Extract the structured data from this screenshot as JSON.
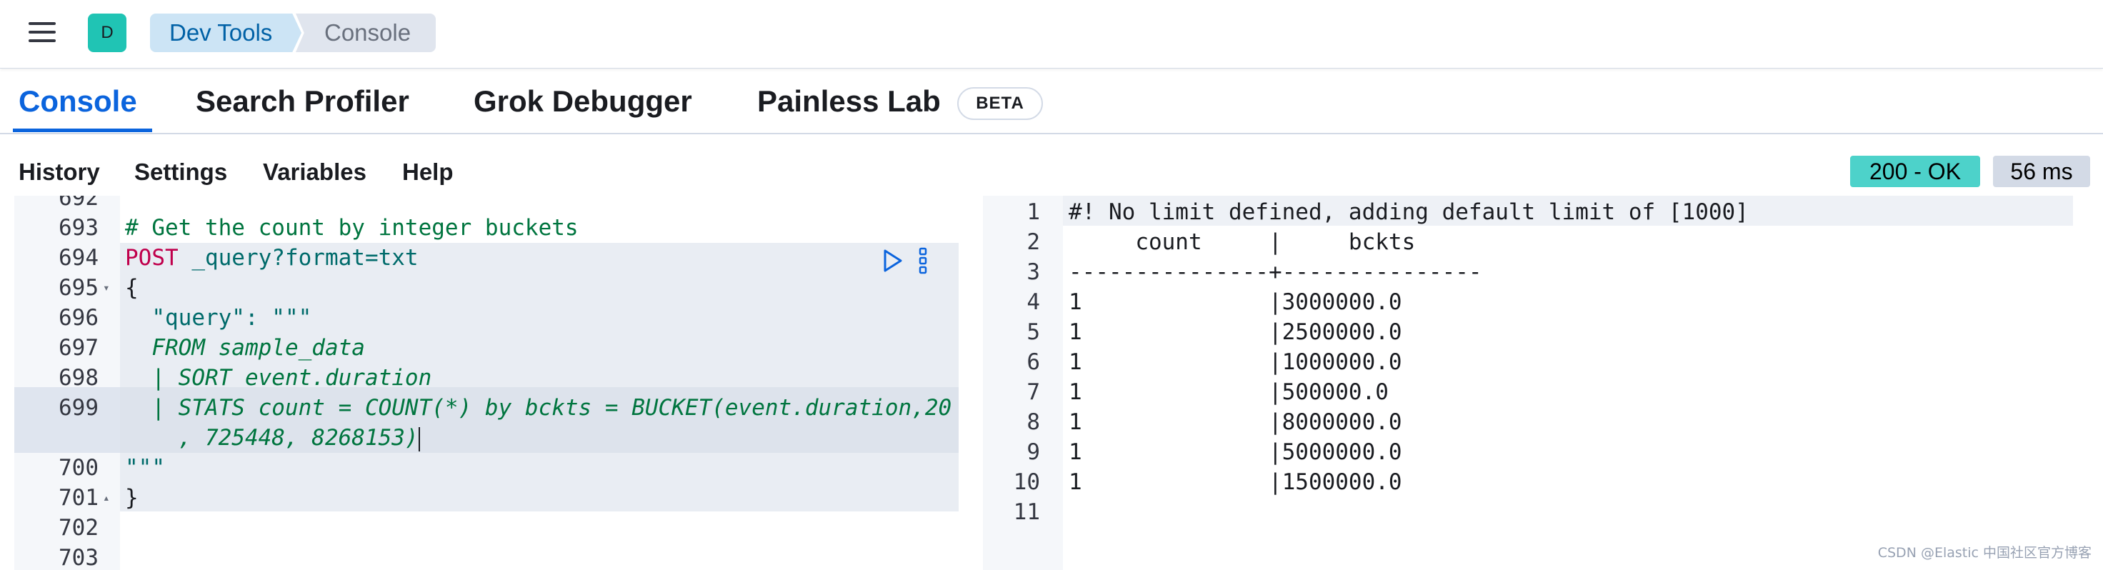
{
  "header": {
    "avatar_letter": "D",
    "breadcrumbs": [
      "Dev Tools",
      "Console"
    ]
  },
  "tabs": [
    {
      "label": "Console",
      "active": true
    },
    {
      "label": "Search Profiler",
      "active": false
    },
    {
      "label": "Grok Debugger",
      "active": false
    },
    {
      "label": "Painless Lab",
      "active": false,
      "badge": "BETA"
    }
  ],
  "toolbar": {
    "items": [
      "History",
      "Settings",
      "Variables",
      "Help"
    ],
    "status": "200 - OK",
    "time": "56 ms"
  },
  "editor": {
    "lines": [
      {
        "num": "692",
        "text": ""
      },
      {
        "num": "693",
        "text": "# Get the count by integer buckets"
      },
      {
        "num": "694",
        "verb": "POST",
        "text": " _query?format=txt"
      },
      {
        "num": "695",
        "text": "{"
      },
      {
        "num": "696",
        "text": "  \"query\": \"\"\""
      },
      {
        "num": "697",
        "text": "  FROM sample_data"
      },
      {
        "num": "698",
        "text": "  | SORT event.duration"
      },
      {
        "num": "699",
        "text": "  | STATS count = COUNT(*) by bckts = BUCKET(event.duration,20"
      },
      {
        "num": "",
        "text": "    , 725448, 8268153)"
      },
      {
        "num": "700",
        "text": "\"\"\""
      },
      {
        "num": "701",
        "text": "}"
      },
      {
        "num": "702",
        "text": ""
      },
      {
        "num": "703",
        "text": ""
      }
    ]
  },
  "output": {
    "lines": [
      {
        "num": "1",
        "text": "#! No limit defined, adding default limit of [1000]"
      },
      {
        "num": "2",
        "text": "     count     |     bckts     "
      },
      {
        "num": "3",
        "text": "---------------+---------------"
      },
      {
        "num": "4",
        "text": "1              |3000000.0      "
      },
      {
        "num": "5",
        "text": "1              |2500000.0      "
      },
      {
        "num": "6",
        "text": "1              |1000000.0      "
      },
      {
        "num": "7",
        "text": "1              |500000.0       "
      },
      {
        "num": "8",
        "text": "1              |8000000.0      "
      },
      {
        "num": "9",
        "text": "1              |5000000.0      "
      },
      {
        "num": "10",
        "text": "1              |1500000.0      "
      },
      {
        "num": "11",
        "text": ""
      }
    ]
  },
  "watermark": "CSDN @Elastic 中国社区官方博客",
  "colors": {
    "accent": "#0b64dd",
    "status_ok": "#4dd2ca",
    "avatar": "#20c4b4"
  }
}
